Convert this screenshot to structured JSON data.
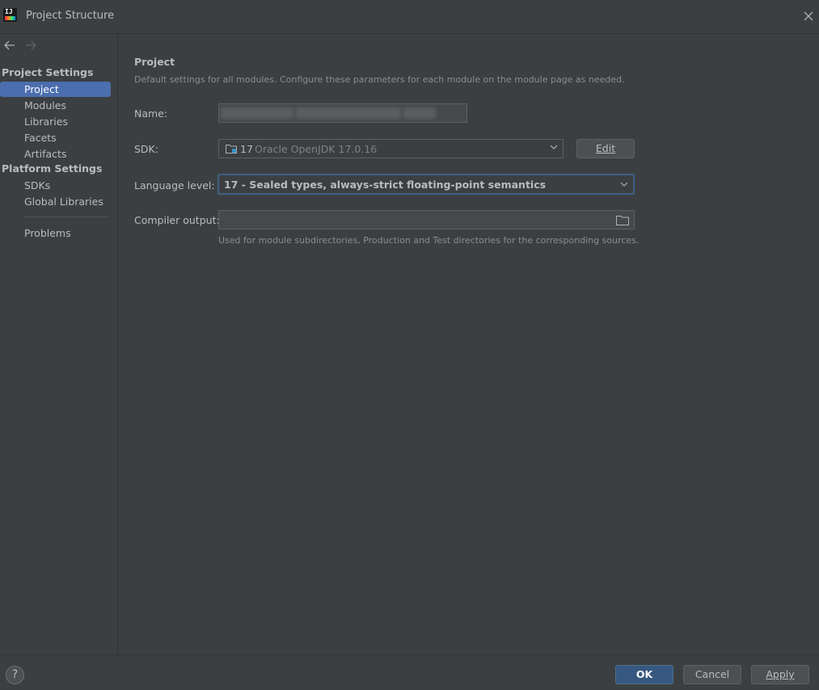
{
  "window": {
    "title": "Project Structure",
    "app_icon_text": "IJ"
  },
  "sidebar": {
    "sections": [
      {
        "header": "Project Settings",
        "items": [
          {
            "label": "Project",
            "selected": true
          },
          {
            "label": "Modules",
            "selected": false
          },
          {
            "label": "Libraries",
            "selected": false
          },
          {
            "label": "Facets",
            "selected": false
          },
          {
            "label": "Artifacts",
            "selected": false
          }
        ]
      },
      {
        "header": "Platform Settings",
        "items": [
          {
            "label": "SDKs",
            "selected": false
          },
          {
            "label": "Global Libraries",
            "selected": false
          }
        ]
      }
    ],
    "problems_label": "Problems"
  },
  "main": {
    "heading": "Project",
    "description": "Default settings for all modules. Configure these parameters for each module on the module page as needed.",
    "name_label": "Name:",
    "sdk_label": "SDK:",
    "sdk_version": "17",
    "sdk_name": "Oracle OpenJDK 17.0.16",
    "edit_button": "Edit",
    "language_level_label": "Language level:",
    "language_level_value": "17 - Sealed types, always-strict floating-point semantics",
    "compiler_output_label": "Compiler output:",
    "compiler_output_value": "",
    "compiler_output_hint": "Used for module subdirectories, Production and Test directories for the corresponding sources."
  },
  "footer": {
    "help": "?",
    "ok": "OK",
    "cancel": "Cancel",
    "apply": "Apply"
  },
  "colors": {
    "background": "#3c3f41",
    "selection": "#4b6eaf",
    "focus_border": "#3d6185",
    "ok_button": "#365880"
  }
}
